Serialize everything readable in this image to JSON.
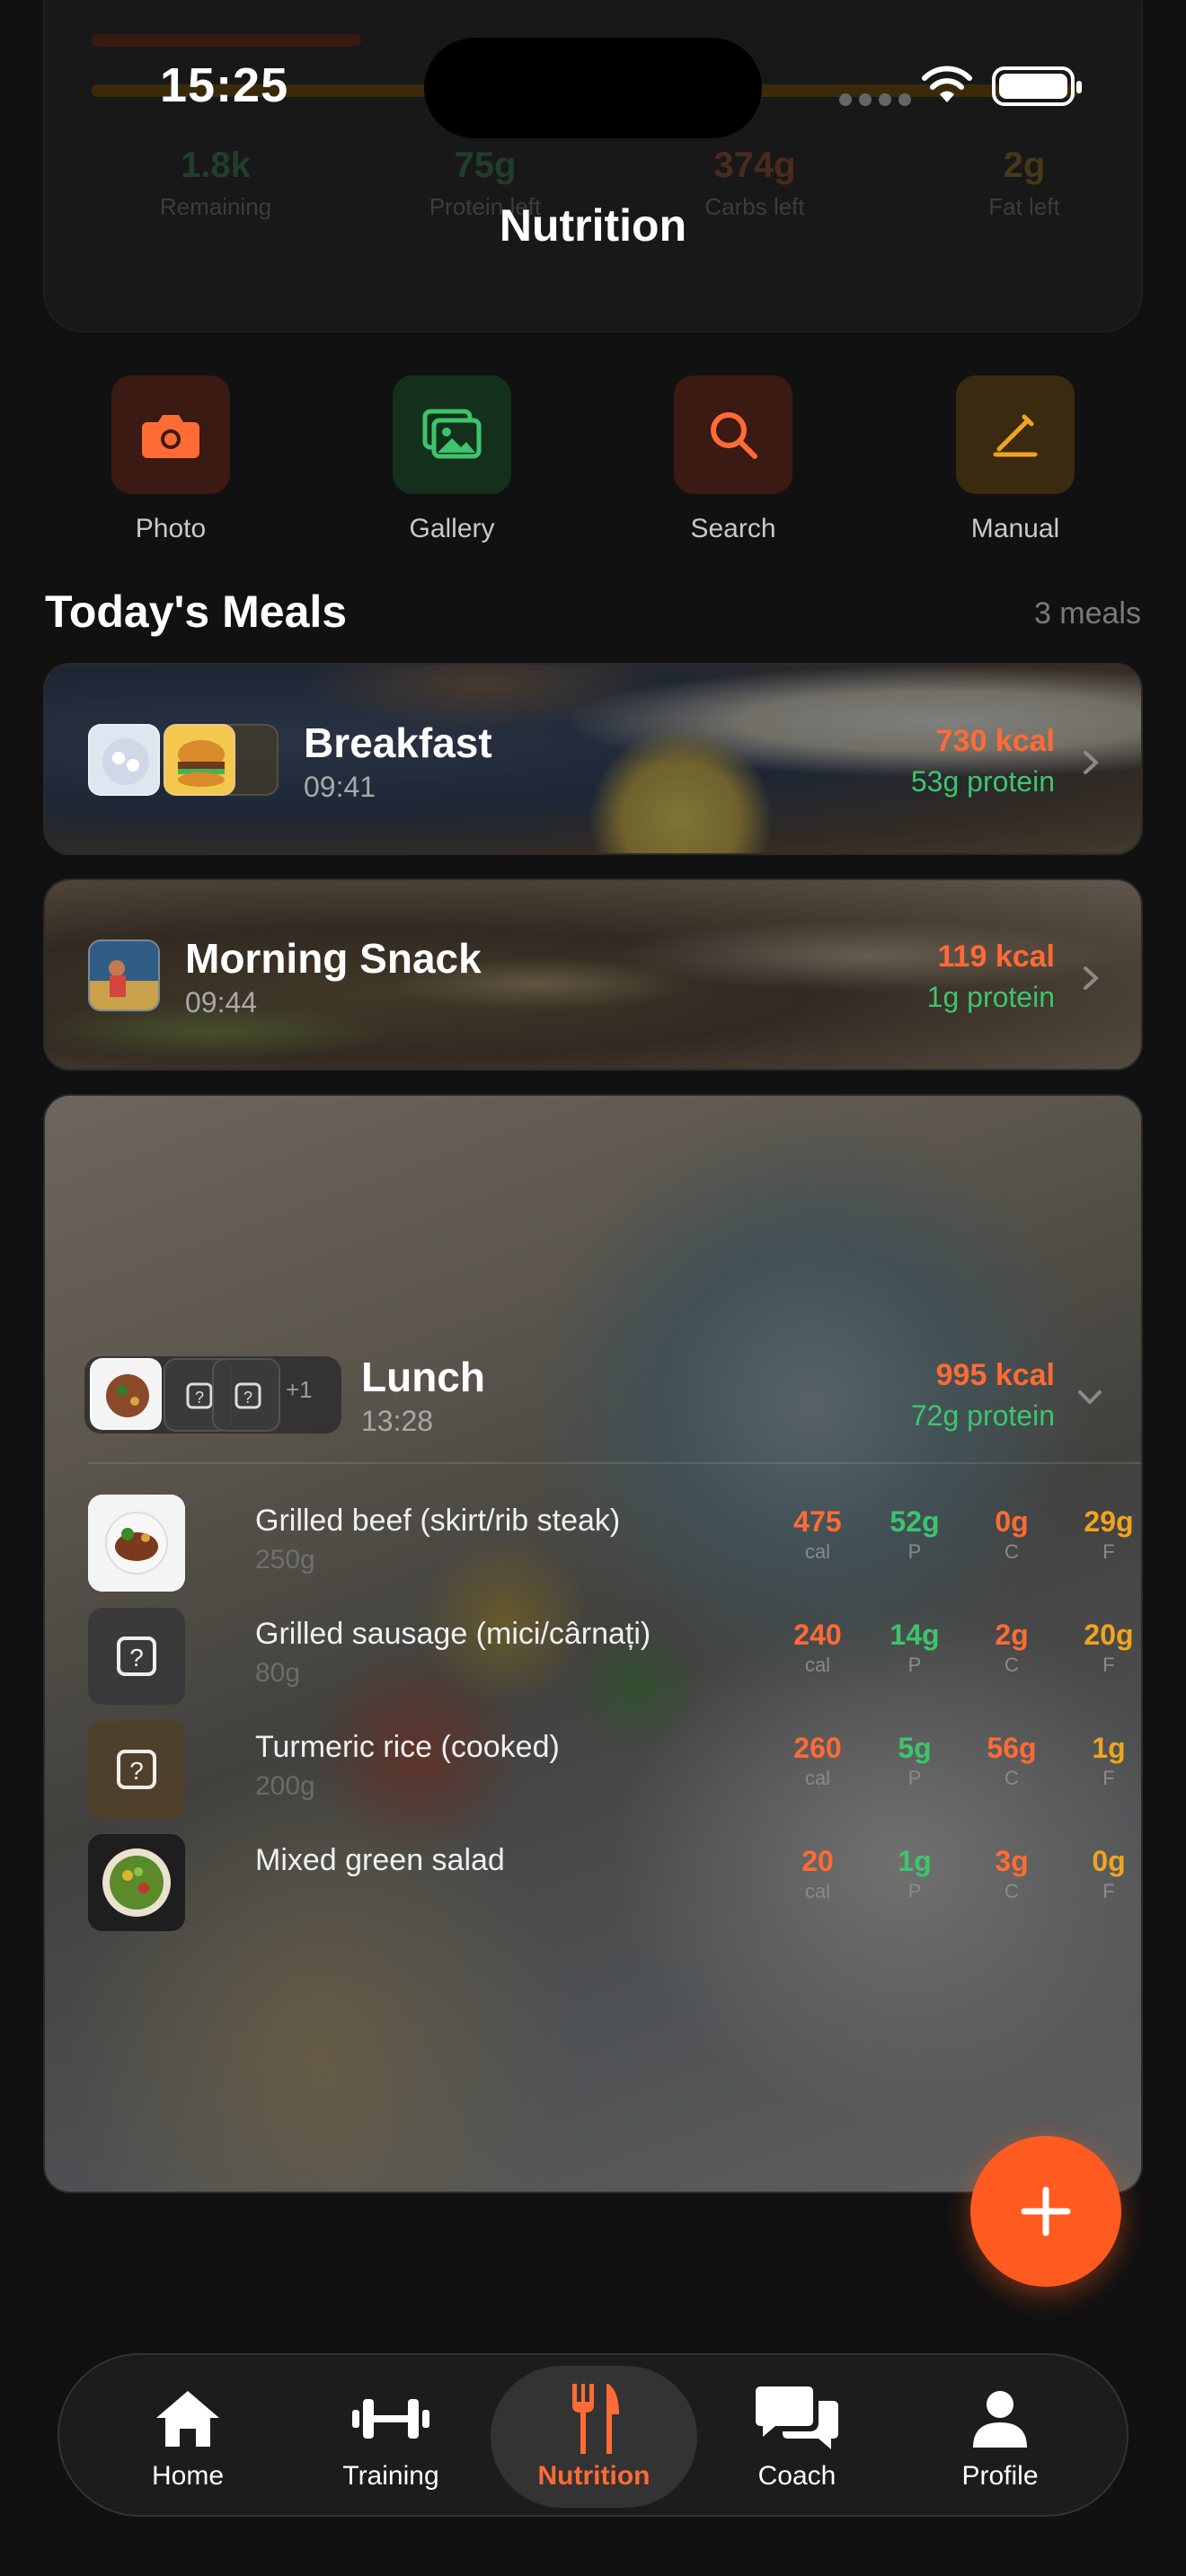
{
  "status_bar": {
    "time": "15:25"
  },
  "header": {
    "title": "Nutrition"
  },
  "summary_faded": {
    "stats": [
      {
        "value": "1.8k",
        "label": "Remaining",
        "color": "#3ec46d"
      },
      {
        "value": "75g",
        "label": "Protein left",
        "color": "#3ec46d"
      },
      {
        "value": "374g",
        "label": "Carbs left",
        "color": "#ff6b35"
      },
      {
        "value": "2g",
        "label": "Fat left",
        "color": "#f0a41e"
      }
    ]
  },
  "quick_actions": [
    {
      "label": "Photo",
      "icon": "camera-icon",
      "color": "#ff6b35"
    },
    {
      "label": "Gallery",
      "icon": "gallery-icon",
      "color": "#3ec46d"
    },
    {
      "label": "Search",
      "icon": "search-icon",
      "color": "#ff6b35"
    },
    {
      "label": "Manual",
      "icon": "pencil-icon",
      "color": "#f0a41e"
    }
  ],
  "meals_section": {
    "title": "Today's Meals",
    "count": "3 meals"
  },
  "meals": [
    {
      "name": "Breakfast",
      "time": "09:41",
      "kcal": "730 kcal",
      "protein": "53g protein"
    },
    {
      "name": "Morning Snack",
      "time": "09:44",
      "kcal": "119 kcal",
      "protein": "1g protein"
    },
    {
      "name": "Lunch",
      "time": "13:28",
      "kcal": "995 kcal",
      "protein": "72g protein",
      "extra_photos": "+1",
      "items": [
        {
          "name": "Grilled beef (skirt/rib steak)",
          "weight": "250g",
          "cal": "475",
          "p": "52g",
          "c": "0g",
          "f": "29g"
        },
        {
          "name": "Grilled sausage (mici/cârnați)",
          "weight": "80g",
          "cal": "240",
          "p": "14g",
          "c": "2g",
          "f": "20g"
        },
        {
          "name": "Turmeric rice (cooked)",
          "weight": "200g",
          "cal": "260",
          "p": "5g",
          "c": "56g",
          "f": "1g"
        },
        {
          "name": "Mixed green salad",
          "weight": "",
          "cal": "20",
          "p": "1g",
          "c": "3g",
          "f": "0g"
        }
      ]
    }
  ],
  "macro_labels": {
    "cal": "cal",
    "p": "P",
    "c": "C",
    "f": "F"
  },
  "tabs": [
    {
      "label": "Home",
      "icon": "home-icon"
    },
    {
      "label": "Training",
      "icon": "dumbbell-icon"
    },
    {
      "label": "Nutrition",
      "icon": "fork-knife-icon",
      "active": true
    },
    {
      "label": "Coach",
      "icon": "chat-icon"
    },
    {
      "label": "Profile",
      "icon": "person-icon"
    }
  ]
}
